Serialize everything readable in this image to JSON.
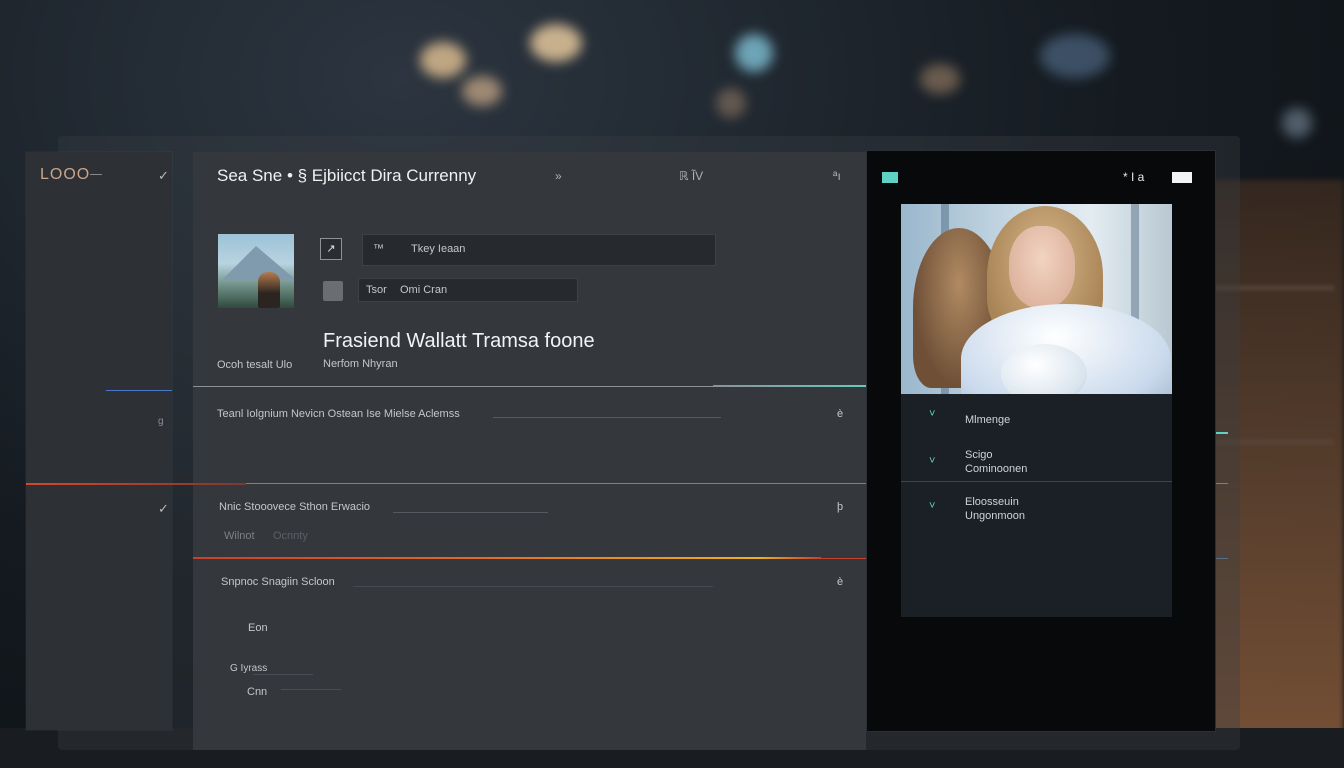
{
  "sidebar": {
    "logo": "LOOO",
    "chevron_top": "✓",
    "chevron_mid": "✓",
    "mini_mark": "g"
  },
  "main": {
    "title": "Sea Sne  • § Ejbiicct Dira Currenny",
    "header_icons": [
      "»",
      "ℝ ĨV",
      "ªı"
    ],
    "thumb_button_icon": "↗",
    "field_1": {
      "icon": "™",
      "value": "Tkey  Ieaan"
    },
    "field_2": {
      "label": "Tsor",
      "value": "Omi Cran"
    },
    "heading": "Frasiend Wallatt  Tramsa foone",
    "sub_left": "Ocoh tesalt Ulo",
    "sub_right": "Nerfom Nhyran",
    "section_1": {
      "label": "Teanl Iolgnium  Nevicn Ostean Ise  Mielse  Aclemss",
      "icon": "è"
    },
    "section_2": {
      "label": "Nnic  Stooovece  Sthon Erwacio",
      "sub_a": "Wilnot",
      "sub_b": "Ocnnty",
      "icon": "þ"
    },
    "section_3": {
      "label": "Snpnoc  Snagiin  Scloon",
      "icon": "è"
    },
    "item_1": "Eon",
    "item_2": "G  Iyrass",
    "item_3": "Cnn"
  },
  "preview": {
    "header_text": "* I a",
    "list": [
      {
        "line1": "Mlmenge",
        "line2": ""
      },
      {
        "line1": "Scigo",
        "line2": "Cominoonen"
      },
      {
        "line1": "Eloosseuin",
        "line2": "Ungonmoon"
      }
    ],
    "chevron": "˅"
  },
  "colors": {
    "accent_teal": "#5fd3c3",
    "accent_blue": "#4b78c8",
    "accent_red": "#d9462b",
    "accent_orange": "#f0a020"
  }
}
